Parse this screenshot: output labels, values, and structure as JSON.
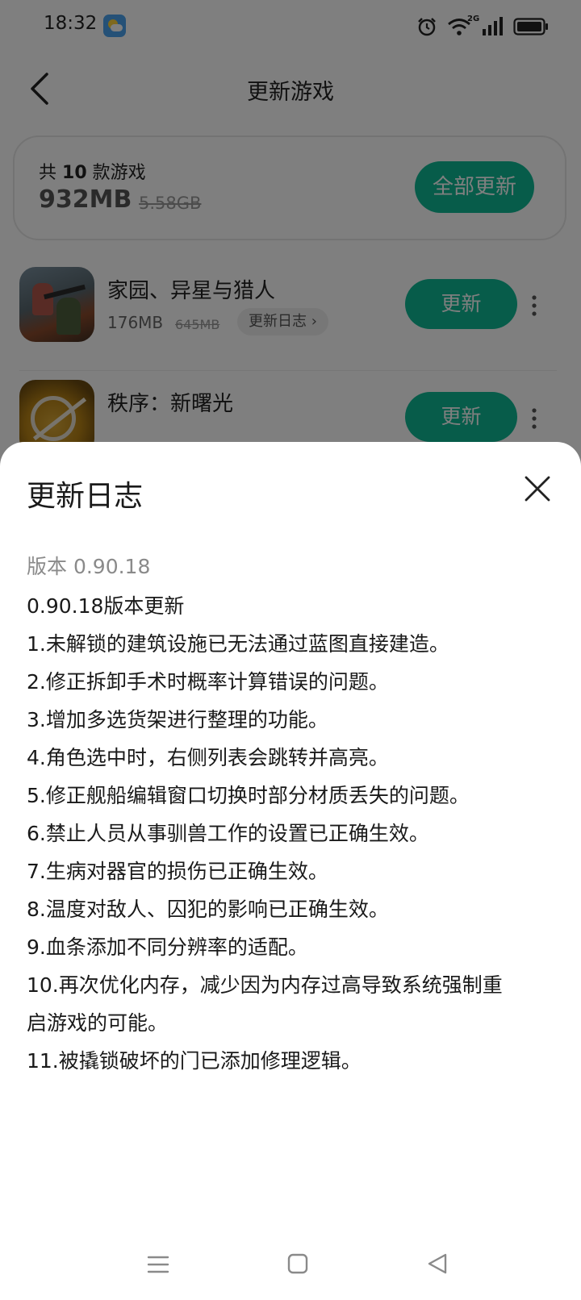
{
  "status_bar": {
    "time": "18:32",
    "network_label": "2G"
  },
  "header": {
    "title": "更新游戏"
  },
  "summary": {
    "count_prefix": "共",
    "count": "10",
    "count_suffix": "款游戏",
    "download_size": "932MB",
    "original_size": "5.58GB",
    "update_all_label": "全部更新"
  },
  "games": [
    {
      "name": "家园、异星与猎人",
      "size": "176MB",
      "original_size": "645MB",
      "changelog_label": "更新日志 ›",
      "update_label": "更新"
    },
    {
      "name": "秩序：新曙光",
      "update_label": "更新"
    }
  ],
  "changelog_sheet": {
    "title": "更新日志",
    "version": "版本 0.90.18",
    "notes": [
      "0.90.18版本更新",
      "1.未解锁的建筑设施已无法通过蓝图直接建造。",
      "2.修正拆卸手术时概率计算错误的问题。",
      "3.增加多选货架进行整理的功能。",
      "4.角色选中时，右侧列表会跳转并高亮。",
      "5.修正舰船编辑窗口切换时部分材质丢失的问题。",
      "6.禁止人员从事驯兽工作的设置已正确生效。",
      "7.生病对器官的损伤已正确生效。",
      "8.温度对敌人、囚犯的影响已正确生效。",
      "9.血条添加不同分辨率的适配。",
      "10.再次优化内存，减少因为内存过高导致系统强制重",
      "启游戏的可能。",
      "11.被撬锁破坏的门已添加修理逻辑。"
    ]
  },
  "colors": {
    "accent": "#0fb894",
    "overlay": "rgba(0,0,0,0.5)"
  },
  "icons": {
    "back": "back-arrow-icon",
    "close": "close-icon",
    "more": "more-vertical-icon",
    "nav": [
      "menu-icon",
      "home-icon",
      "back-triangle-icon"
    ]
  }
}
